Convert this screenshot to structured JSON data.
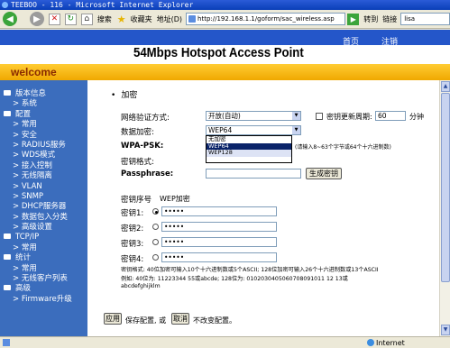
{
  "window": {
    "title": "TEEBOO - 116 - Microsoft Internet Explorer"
  },
  "toolbar": {
    "back_label": "",
    "search_label": "搜索",
    "favorites_label": "收藏夹",
    "address_label": "地址(D)",
    "address_url": "http://192.168.1.1/goform/sac_wireless.asp",
    "go_label": "转到",
    "links_label": "链接",
    "search_box": "lisa"
  },
  "banner": {
    "title": "54Mbps Hotspot Access Point",
    "nav_home": "首页",
    "nav_logout": "注销"
  },
  "welcome": "welcome",
  "sidebar": {
    "items": [
      {
        "type": "head",
        "label": "版本信息"
      },
      {
        "type": "sub",
        "label": "系统"
      },
      {
        "type": "head",
        "label": "配置"
      },
      {
        "type": "sub",
        "label": "常用"
      },
      {
        "type": "sub",
        "label": "安全"
      },
      {
        "type": "sub",
        "label": "RADIUS服务"
      },
      {
        "type": "sub",
        "label": "WDS模式"
      },
      {
        "type": "sub",
        "label": "接入控制"
      },
      {
        "type": "sub",
        "label": "无线隔离"
      },
      {
        "type": "sub",
        "label": "VLAN"
      },
      {
        "type": "sub",
        "label": "SNMP"
      },
      {
        "type": "sub",
        "label": "DHCP服务器"
      },
      {
        "type": "sub",
        "label": "数据包入分类"
      },
      {
        "type": "sub",
        "label": "高级设置"
      },
      {
        "type": "head",
        "label": "TCP/IP"
      },
      {
        "type": "sub",
        "label": "常用"
      },
      {
        "type": "head",
        "label": "统计"
      },
      {
        "type": "sub",
        "label": "常用"
      },
      {
        "type": "sub",
        "label": "无线客户列表"
      },
      {
        "type": "head",
        "label": "高级"
      },
      {
        "type": "sub",
        "label": "Firmware升级"
      }
    ]
  },
  "form": {
    "section_title": "加密",
    "auth_label": "网络验证方式:",
    "auth_value": "开放(自动)",
    "rekey_label": "密钥更新周期:",
    "rekey_value": "60",
    "rekey_unit": "分钟",
    "encrypt_label": "数据加密:",
    "encrypt_value": "WEP64",
    "encrypt_options": [
      "无加密",
      "WEP64",
      "WEP128"
    ],
    "encrypt_selected": "WEP64",
    "psk_label": "WPA-PSK:",
    "psk_hint": "(请输入8~63个字节或64个十六进制数)",
    "key_format_label": "密钥格式:",
    "passphrase_label": "Passphrase:",
    "generate_button": "生成密钥",
    "key_index_label": "密钥序号",
    "wep_label": "WEP加密",
    "keys": [
      {
        "label": "密钥1:",
        "value": "•••••",
        "checked": true
      },
      {
        "label": "密钥2:",
        "value": "•••••",
        "checked": false
      },
      {
        "label": "密钥3:",
        "value": "•••••",
        "checked": false
      },
      {
        "label": "密钥4:",
        "value": "•••••",
        "checked": false
      }
    ],
    "note_line1": "密钥格式: 40位加密可输入10个十六进制数或5个ASCII; 128位加密可输入26个十六进制数或13个ASCII",
    "note_line2": "例如: 40位为: 11223344 55或abcde; 128位为: 0102030405060708091011 12 13或",
    "note_line3": "abcdefghijklm",
    "apply_button": "应用",
    "apply_text": "保存配置, 或",
    "cancel_button": "取消",
    "cancel_text": "不改变配置。"
  },
  "statusbar": {
    "zone": "Internet"
  }
}
